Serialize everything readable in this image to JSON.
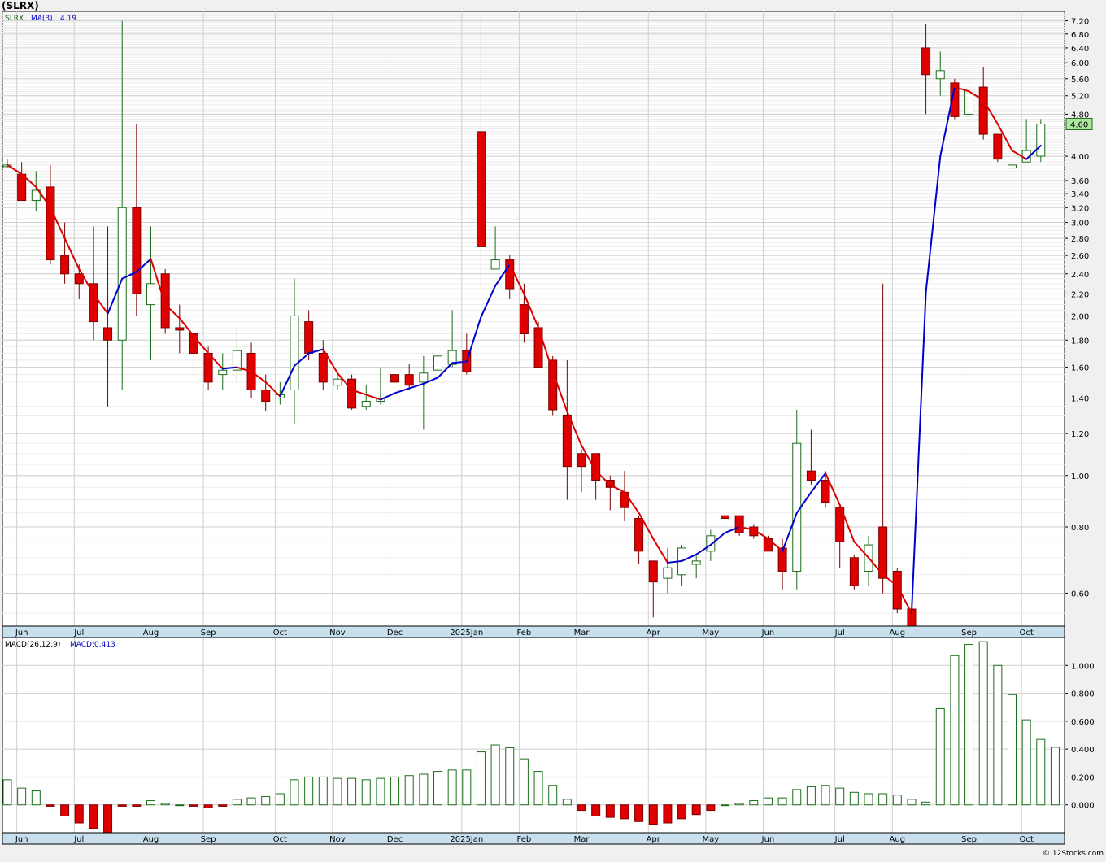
{
  "title": "(SLRX)",
  "watermark": "© 12Stocks.com",
  "colors": {
    "up": "#1a6e1a",
    "down": "#e00000",
    "ma_up": "#0000cc",
    "ma_down": "#dd0000",
    "axis_band": "#c8e0ee",
    "grid": "#cfcfcf",
    "last_price_bg": "#aee6a0"
  },
  "chart_data": [
    {
      "type": "candlestick",
      "symbol_label": "SLRX",
      "ma_label": "MA(3)",
      "ma_value": "4.19",
      "last_price": "4.60",
      "y_scale": "log",
      "ylim": [
        0.52,
        7.5
      ],
      "y_ticks": [
        "0.60",
        "0.80",
        "1.00",
        "1.20",
        "1.40",
        "1.60",
        "1.80",
        "2.00",
        "2.20",
        "2.40",
        "2.60",
        "2.80",
        "3.00",
        "3.20",
        "3.40",
        "3.60",
        "4.00",
        "4.80",
        "5.20",
        "5.60",
        "6.00",
        "6.40",
        "6.80",
        "7.20"
      ],
      "x_labels": [
        "Jun",
        "Jul",
        "Aug",
        "Sep",
        "Oct",
        "Nov",
        "Dec",
        "2025Jan",
        "Feb",
        "Mar",
        "Apr",
        "May",
        "Jun",
        "Jul",
        "Aug",
        "Sep",
        "Oct"
      ],
      "x_label_week": [
        1,
        5,
        10,
        14,
        19,
        23,
        27,
        32,
        36,
        40,
        45,
        49,
        53,
        58,
        62,
        67,
        71
      ],
      "grid": true,
      "candles": [
        {
          "o": 3.85,
          "h": 3.95,
          "l": 3.8,
          "c": 3.85
        },
        {
          "o": 3.7,
          "h": 3.9,
          "l": 3.3,
          "c": 3.3
        },
        {
          "o": 3.3,
          "h": 3.75,
          "l": 3.15,
          "c": 3.45
        },
        {
          "o": 3.5,
          "h": 3.85,
          "l": 2.5,
          "c": 2.55
        },
        {
          "o": 2.6,
          "h": 3.0,
          "l": 2.3,
          "c": 2.4
        },
        {
          "o": 2.4,
          "h": 2.5,
          "l": 2.15,
          "c": 2.3
        },
        {
          "o": 2.3,
          "h": 2.95,
          "l": 1.8,
          "c": 1.95
        },
        {
          "o": 1.9,
          "h": 2.95,
          "l": 1.35,
          "c": 1.8
        },
        {
          "o": 1.8,
          "h": 7.2,
          "l": 1.45,
          "c": 3.2
        },
        {
          "o": 3.2,
          "h": 4.6,
          "l": 2.0,
          "c": 2.2
        },
        {
          "o": 2.1,
          "h": 2.95,
          "l": 1.65,
          "c": 2.3
        },
        {
          "o": 2.4,
          "h": 2.45,
          "l": 1.85,
          "c": 1.9
        },
        {
          "o": 1.9,
          "h": 2.1,
          "l": 1.7,
          "c": 1.88
        },
        {
          "o": 1.85,
          "h": 1.9,
          "l": 1.55,
          "c": 1.7
        },
        {
          "o": 1.7,
          "h": 1.75,
          "l": 1.45,
          "c": 1.5
        },
        {
          "o": 1.55,
          "h": 1.7,
          "l": 1.45,
          "c": 1.58
        },
        {
          "o": 1.58,
          "h": 1.9,
          "l": 1.5,
          "c": 1.72
        },
        {
          "o": 1.7,
          "h": 1.78,
          "l": 1.4,
          "c": 1.45
        },
        {
          "o": 1.45,
          "h": 1.55,
          "l": 1.32,
          "c": 1.38
        },
        {
          "o": 1.4,
          "h": 1.5,
          "l": 1.36,
          "c": 1.42
        },
        {
          "o": 1.45,
          "h": 2.35,
          "l": 1.25,
          "c": 2.0
        },
        {
          "o": 1.95,
          "h": 2.05,
          "l": 1.65,
          "c": 1.7
        },
        {
          "o": 1.7,
          "h": 1.8,
          "l": 1.45,
          "c": 1.5
        },
        {
          "o": 1.48,
          "h": 1.55,
          "l": 1.45,
          "c": 1.52
        },
        {
          "o": 1.52,
          "h": 1.55,
          "l": 1.33,
          "c": 1.34
        },
        {
          "o": 1.35,
          "h": 1.48,
          "l": 1.33,
          "c": 1.38
        },
        {
          "o": 1.38,
          "h": 1.6,
          "l": 1.36,
          "c": 1.4
        },
        {
          "o": 1.55,
          "h": 1.55,
          "l": 1.5,
          "c": 1.5
        },
        {
          "o": 1.55,
          "h": 1.62,
          "l": 1.45,
          "c": 1.48
        },
        {
          "o": 1.5,
          "h": 1.68,
          "l": 1.22,
          "c": 1.56
        },
        {
          "o": 1.58,
          "h": 1.72,
          "l": 1.4,
          "c": 1.68
        },
        {
          "o": 1.62,
          "h": 2.05,
          "l": 1.6,
          "c": 1.72
        },
        {
          "o": 1.72,
          "h": 1.85,
          "l": 1.55,
          "c": 1.57
        },
        {
          "o": 4.45,
          "h": 7.2,
          "l": 2.25,
          "c": 2.7
        },
        {
          "o": 2.45,
          "h": 2.95,
          "l": 2.45,
          "c": 2.55
        },
        {
          "o": 2.55,
          "h": 2.6,
          "l": 2.15,
          "c": 2.25
        },
        {
          "o": 2.1,
          "h": 2.3,
          "l": 1.78,
          "c": 1.85
        },
        {
          "o": 1.9,
          "h": 1.95,
          "l": 1.6,
          "c": 1.6
        },
        {
          "o": 1.65,
          "h": 1.68,
          "l": 1.3,
          "c": 1.33
        },
        {
          "o": 1.3,
          "h": 1.65,
          "l": 0.9,
          "c": 1.04
        },
        {
          "o": 1.1,
          "h": 1.12,
          "l": 0.93,
          "c": 1.04
        },
        {
          "o": 1.1,
          "h": 1.1,
          "l": 0.9,
          "c": 0.98
        },
        {
          "o": 0.98,
          "h": 1.0,
          "l": 0.86,
          "c": 0.95
        },
        {
          "o": 0.93,
          "h": 1.02,
          "l": 0.82,
          "c": 0.87
        },
        {
          "o": 0.83,
          "h": 0.84,
          "l": 0.68,
          "c": 0.72
        },
        {
          "o": 0.69,
          "h": 0.69,
          "l": 0.54,
          "c": 0.63
        },
        {
          "o": 0.64,
          "h": 0.73,
          "l": 0.6,
          "c": 0.67
        },
        {
          "o": 0.65,
          "h": 0.74,
          "l": 0.62,
          "c": 0.73
        },
        {
          "o": 0.68,
          "h": 0.71,
          "l": 0.64,
          "c": 0.69
        },
        {
          "o": 0.72,
          "h": 0.79,
          "l": 0.69,
          "c": 0.77
        },
        {
          "o": 0.84,
          "h": 0.86,
          "l": 0.82,
          "c": 0.83
        },
        {
          "o": 0.84,
          "h": 0.84,
          "l": 0.77,
          "c": 0.78
        },
        {
          "o": 0.8,
          "h": 0.81,
          "l": 0.76,
          "c": 0.77
        },
        {
          "o": 0.76,
          "h": 0.77,
          "l": 0.72,
          "c": 0.72
        },
        {
          "o": 0.73,
          "h": 0.76,
          "l": 0.61,
          "c": 0.66
        },
        {
          "o": 0.66,
          "h": 1.33,
          "l": 0.61,
          "c": 1.15
        },
        {
          "o": 1.02,
          "h": 1.22,
          "l": 0.96,
          "c": 0.98
        },
        {
          "o": 0.98,
          "h": 1.02,
          "l": 0.87,
          "c": 0.89
        },
        {
          "o": 0.87,
          "h": 0.88,
          "l": 0.67,
          "c": 0.75
        },
        {
          "o": 0.7,
          "h": 0.71,
          "l": 0.61,
          "c": 0.62
        },
        {
          "o": 0.66,
          "h": 0.77,
          "l": 0.62,
          "c": 0.74
        },
        {
          "o": 0.8,
          "h": 2.3,
          "l": 0.6,
          "c": 0.64
        },
        {
          "o": 0.66,
          "h": 0.67,
          "l": 0.55,
          "c": 0.56
        },
        {
          "o": 0.56,
          "h": 0.56,
          "l": 0.52,
          "c": 0.52
        },
        {
          "o": 6.4,
          "h": 7.1,
          "l": 4.8,
          "c": 5.7
        },
        {
          "o": 5.6,
          "h": 6.3,
          "l": 5.2,
          "c": 5.8
        },
        {
          "o": 5.5,
          "h": 5.6,
          "l": 4.7,
          "c": 4.75
        },
        {
          "o": 4.8,
          "h": 5.6,
          "l": 4.6,
          "c": 5.35
        },
        {
          "o": 5.4,
          "h": 5.9,
          "l": 4.3,
          "c": 4.4
        },
        {
          "o": 4.4,
          "h": 4.4,
          "l": 3.9,
          "c": 3.95
        },
        {
          "o": 3.8,
          "h": 3.95,
          "l": 3.7,
          "c": 3.85
        },
        {
          "o": 3.9,
          "h": 4.7,
          "l": 3.9,
          "c": 4.1
        },
        {
          "o": 4.0,
          "h": 4.7,
          "l": 3.9,
          "c": 4.6
        }
      ],
      "ma": [
        3.85,
        3.7,
        3.5,
        3.2,
        2.8,
        2.45,
        2.2,
        2.02,
        2.35,
        2.42,
        2.56,
        2.1,
        1.98,
        1.83,
        1.7,
        1.59,
        1.6,
        1.57,
        1.5,
        1.41,
        1.61,
        1.7,
        1.73,
        1.56,
        1.45,
        1.42,
        1.39,
        1.43,
        1.46,
        1.49,
        1.53,
        1.63,
        1.64,
        1.99,
        2.28,
        2.5,
        2.2,
        1.9,
        1.57,
        1.32,
        1.14,
        1.02,
        0.96,
        0.93,
        0.85,
        0.76,
        0.685,
        0.69,
        0.71,
        0.74,
        0.78,
        0.8,
        0.79,
        0.76,
        0.72,
        0.85,
        0.93,
        1.01,
        0.88,
        0.75,
        0.7,
        0.65,
        0.62,
        0.55,
        2.22,
        4.0,
        5.4,
        5.3,
        5.1,
        4.6,
        4.1,
        3.95,
        4.19
      ]
    },
    {
      "type": "bar",
      "label": "MACD(26,12,9)",
      "value_label": "MACD:0.413",
      "ylim": [
        -0.2,
        1.2
      ],
      "y_ticks": [
        "0.000",
        "0.200",
        "0.400",
        "0.600",
        "0.800",
        "1.000"
      ],
      "x_labels": [
        "Jun",
        "Jul",
        "Aug",
        "Sep",
        "Oct",
        "Nov",
        "Dec",
        "2025Jan",
        "Feb",
        "Mar",
        "Apr",
        "May",
        "Jun",
        "Jul",
        "Aug",
        "Sep",
        "Oct"
      ],
      "x_label_week": [
        1,
        5,
        10,
        14,
        19,
        23,
        27,
        32,
        36,
        40,
        45,
        49,
        53,
        58,
        62,
        67,
        71
      ],
      "values": [
        0.18,
        0.12,
        0.1,
        -0.01,
        -0.08,
        -0.13,
        -0.17,
        -0.2,
        -0.01,
        -0.01,
        0.03,
        0.01,
        0.0,
        -0.01,
        -0.02,
        -0.01,
        0.04,
        0.05,
        0.06,
        0.08,
        0.18,
        0.2,
        0.2,
        0.19,
        0.19,
        0.18,
        0.19,
        0.2,
        0.21,
        0.22,
        0.24,
        0.25,
        0.25,
        0.38,
        0.43,
        0.41,
        0.33,
        0.24,
        0.14,
        0.04,
        -0.04,
        -0.08,
        -0.09,
        -0.1,
        -0.12,
        -0.14,
        -0.13,
        -0.1,
        -0.07,
        -0.04,
        0.0,
        0.01,
        0.03,
        0.05,
        0.05,
        0.11,
        0.13,
        0.14,
        0.12,
        0.09,
        0.08,
        0.08,
        0.07,
        0.04,
        0.02,
        0.69,
        1.07,
        1.15,
        1.17,
        1.0,
        0.79,
        0.61,
        0.47,
        0.413
      ]
    }
  ]
}
